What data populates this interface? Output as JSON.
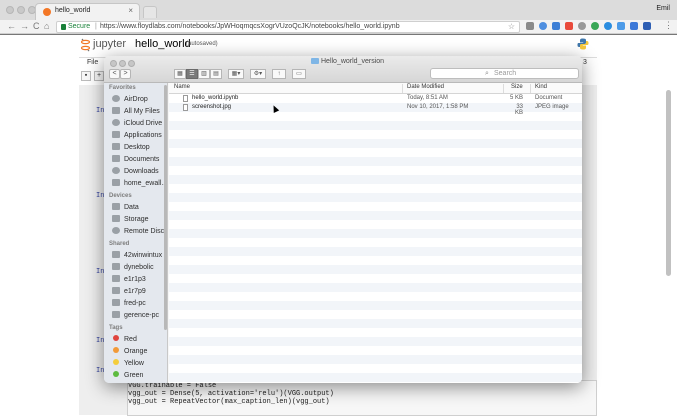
{
  "browser": {
    "tab_title": "hello_world",
    "tab_close": "×",
    "user": "Emil",
    "secure_label": "Secure",
    "separator": "|",
    "url": "https://www.floydlabs.com/notebooks/JpWHoqmqcsXogrVUzoQcJK/notebooks/hello_world.ipynb",
    "back": "←",
    "forward": "→",
    "reload": "C",
    "home": "⌂",
    "star": "☆"
  },
  "jupyter": {
    "logo_text": "jupyter",
    "notebook_name": "hello_world",
    "autosaved": "(autosaved)",
    "menu_file": "File",
    "menu_trailing": "3",
    "prompts": [
      "In",
      "In",
      "In",
      "In",
      "In"
    ],
    "code_lines": [
      "VGG.trainable = False",
      "vgg_out = Dense(5, activation='relu')(VGG.output)",
      "vgg_out = RepeatVector(max_caption_len)(vgg_out)"
    ]
  },
  "dialog": {
    "title": "Hello_world_version",
    "back": "<",
    "forward": ">",
    "search_placeholder": "Search",
    "search_glyph": "⌕",
    "sidebar": {
      "favorites_header": "Favorites",
      "favorites": [
        "AirDrop",
        "All My Files",
        "iCloud Drive",
        "Applications",
        "Desktop",
        "Documents",
        "Downloads",
        "home_ewall..."
      ],
      "devices_header": "Devices",
      "devices": [
        "Data",
        "Storage",
        "Remote Disc"
      ],
      "shared_header": "Shared",
      "shared": [
        "42winwintux",
        "dynebolic",
        "e1r1p3",
        "e1r7p9",
        "fred-pc",
        "gerence-pc"
      ],
      "tags_header": "Tags",
      "tags": [
        {
          "label": "Red",
          "color": "#e0443e"
        },
        {
          "label": "Orange",
          "color": "#f29a38"
        },
        {
          "label": "Yellow",
          "color": "#f4cd3b"
        },
        {
          "label": "Green",
          "color": "#5dbb3f"
        }
      ]
    },
    "columns": {
      "name": "Name",
      "date": "Date Modified",
      "size": "Size",
      "kind": "Kind"
    },
    "files": [
      {
        "name": "hello_world.ipynb",
        "date": "Today, 8:51 AM",
        "size": "5 KB",
        "kind": "Document"
      },
      {
        "name": "screenshot.jpg",
        "date": "Nov 10, 2017, 1:58 PM",
        "size": "33 KB",
        "kind": "JPEG image"
      }
    ]
  }
}
